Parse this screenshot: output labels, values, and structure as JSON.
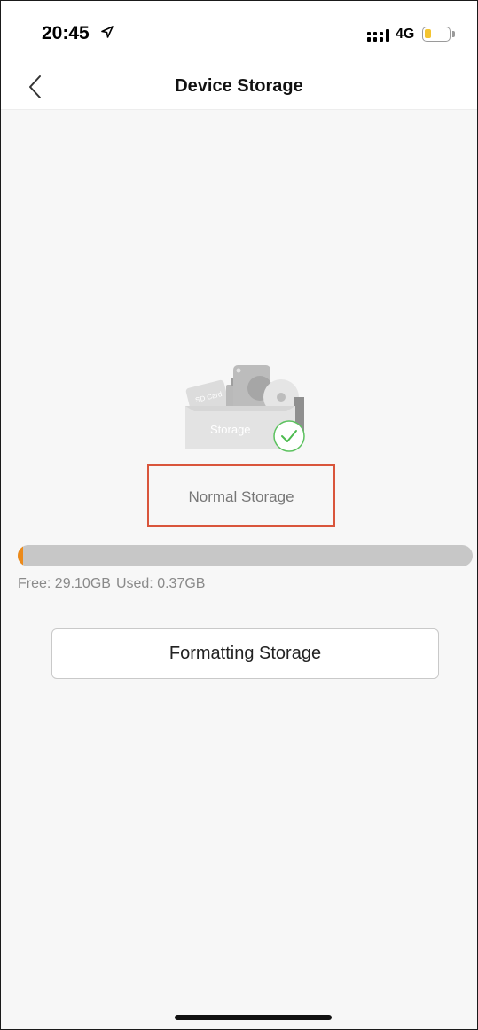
{
  "status_bar": {
    "time": "20:45",
    "network": "4G",
    "battery_level": 0.25,
    "battery_color": "#f4c430"
  },
  "nav": {
    "back_icon": "chevron-left-icon",
    "title": "Device Storage"
  },
  "illustration": {
    "label": "Storage",
    "badge_icon": "checkmark-icon",
    "badge_color": "#4cbb4f"
  },
  "storage": {
    "status": "Normal Storage",
    "used_fraction": 0.0126,
    "free_label": "Free: 29.10GB",
    "used_label": "Used: 0.37GB",
    "accent_color": "#ec8a1a"
  },
  "actions": {
    "format_label": "Formatting Storage"
  },
  "highlight_color": "#d9553b"
}
